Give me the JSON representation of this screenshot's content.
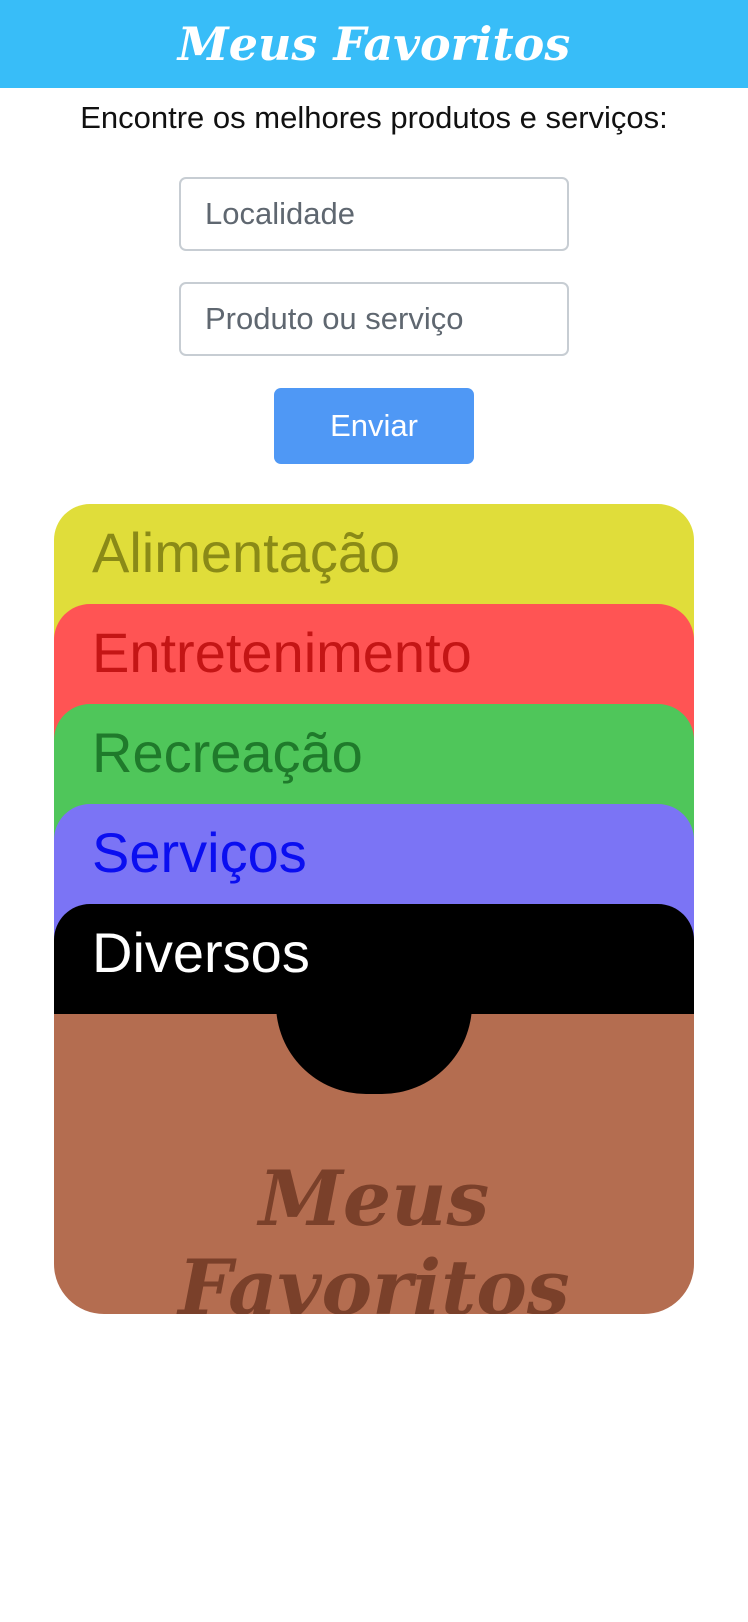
{
  "header": {
    "title": "Meus Favoritos"
  },
  "search": {
    "subtitle": "Encontre os melhores produtos e serviços:",
    "location_placeholder": "Localidade",
    "product_placeholder": "Produto ou serviço",
    "submit_label": "Enviar"
  },
  "categories": [
    {
      "label": "Alimentação",
      "color": "#e0dd3a"
    },
    {
      "label": "Entretenimento",
      "color": "#ff5454"
    },
    {
      "label": "Recreação",
      "color": "#4fc65a"
    },
    {
      "label": "Serviços",
      "color": "#7b74f5"
    },
    {
      "label": "Diversos",
      "color": "#000000"
    }
  ],
  "wallet": {
    "label": "Meus Favoritos",
    "color": "#b46d50"
  },
  "colors": {
    "accent": "#38bdf8",
    "button": "#4f98f5"
  }
}
